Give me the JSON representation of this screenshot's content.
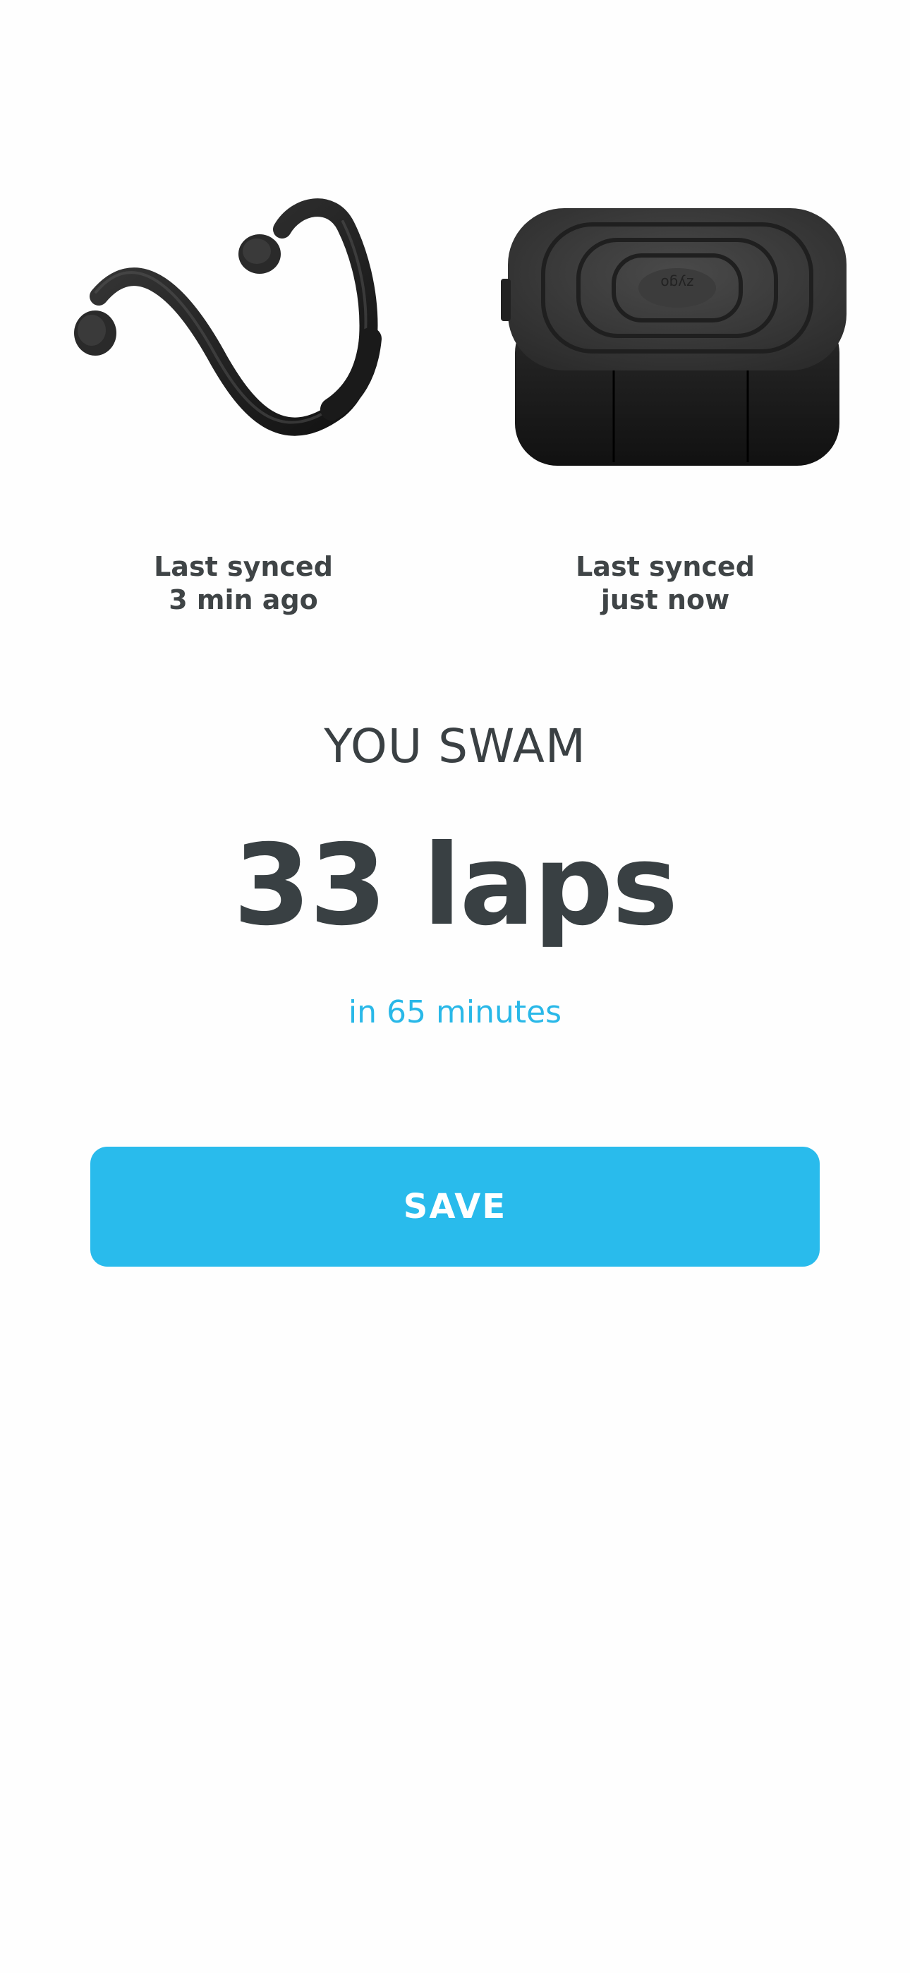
{
  "devices": [
    {
      "icon": "headphones-icon",
      "sync_line1": "Last synced",
      "sync_line2": "3 min ago"
    },
    {
      "icon": "charging-pod-icon",
      "brand_mark": "zygo",
      "sync_line1": "Last synced",
      "sync_line2": "just now"
    }
  ],
  "summary": {
    "title": "YOU SWAM",
    "laps": "33 laps",
    "duration": "in 65 minutes"
  },
  "actions": {
    "save_label": "SAVE"
  },
  "colors": {
    "accent": "#29bbec",
    "text_dark": "#394043",
    "background": "#fefefe"
  }
}
